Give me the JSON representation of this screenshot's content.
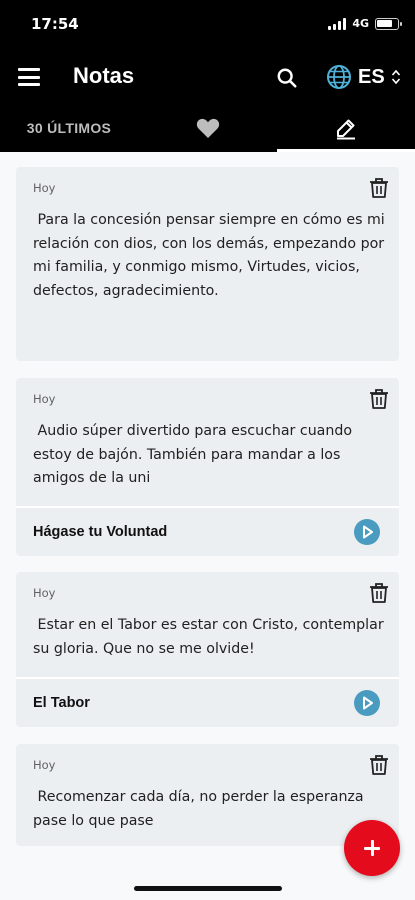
{
  "status_bar": {
    "time": "17:54",
    "network": "4G",
    "battery_level": 0.8
  },
  "app_bar": {
    "title": "Notas",
    "language": "ES",
    "icons": [
      "menu-icon",
      "search-icon",
      "globe-icon",
      "chevron-updown-icon"
    ]
  },
  "tabs": {
    "recent_label": "30 ÚLTIMOS",
    "favorites_icon": "heart-icon",
    "notes_icon": "pencil-icon",
    "selected": "notes"
  },
  "notes": [
    {
      "date": "Hoy",
      "text": " Para la concesión pensar siempre en cómo es mi relación con dios, con los demás, empezando por mi familia, y conmigo mismo, Virtudes, vicios, defectos, agradecimiento."
    },
    {
      "date": "Hoy",
      "text": " Audio súper divertido para escuchar cuando estoy de bajón. También para mandar a los amigos de la uni",
      "audio_title": "Hágase tu Voluntad"
    },
    {
      "date": "Hoy",
      "text": " Estar en el Tabor es estar con Cristo, contemplar su gloria. Que no se me olvide!",
      "audio_title": "El Tabor"
    },
    {
      "date": "Hoy",
      "text": " Recomenzar cada día, no perder la esperanza pase lo que pase"
    }
  ],
  "colors": {
    "header_bg": "#000000",
    "card_bg": "#eceff1",
    "play_accent": "#4a9bc0",
    "fab": "#e30b1c"
  }
}
